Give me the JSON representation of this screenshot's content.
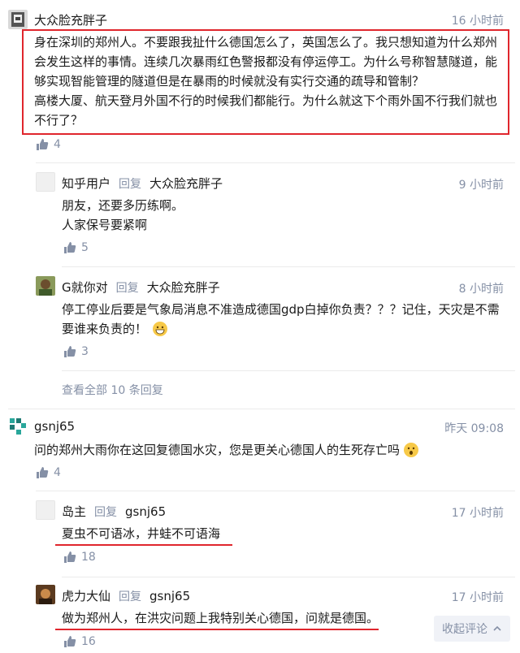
{
  "comments": [
    {
      "author": "大众脸充胖子",
      "time": "16 小时前",
      "lines": [
        "身在深圳的郑州人。不要跟我扯什么德国怎么了，英国怎么了。我只想知道为什么郑州",
        "会发生这样的事情。连续几次暴雨红色警报都没有停运停工。为什么号称智慧隧道，能",
        "够实现智能管理的隧道但是在暴雨的时候就没有实行交通的疏导和管制？",
        "高楼大厦、航天登月外国不行的时候我们都能行。为什么就这下个雨外国不行我们就也",
        "不行了？"
      ],
      "likes": "4",
      "replies": [
        {
          "author": "知乎用户",
          "reply_word": "回复",
          "reply_to": "大众脸充胖子",
          "time": "9 小时前",
          "lines": [
            "朋友，还要多历练啊。",
            "人家保号要紧啊"
          ],
          "likes": "5"
        },
        {
          "author": "G就你对",
          "reply_word": "回复",
          "reply_to": "大众脸充胖子",
          "time": "8 小时前",
          "lines": [
            "停工停业后要是气象局消息不准造成德国gdp白掉你负责？？？记住，天灾是不需",
            "要谁来负责的！"
          ],
          "likes": "3"
        }
      ],
      "view_all": "查看全部 10 条回复"
    },
    {
      "author": "gsnj65",
      "time": "昨天 09:08",
      "lines": [
        "问的郑州大雨你在这回复德国水灾，您是更关心德国人的生死存亡吗"
      ],
      "likes": "4",
      "replies": [
        {
          "author": "岛主",
          "reply_word": "回复",
          "reply_to": "gsnj65",
          "time": "17 小时前",
          "lines": [
            "夏虫不可语冰，井蛙不可语海"
          ],
          "likes": "18"
        },
        {
          "author": "虎力大仙",
          "reply_word": "回复",
          "reply_to": "gsnj65",
          "time": "17 小时前",
          "lines": [
            "做为郑州人，在洪灾问题上我特别关心德国，问就是德国。"
          ],
          "likes": "16"
        }
      ]
    }
  ],
  "collapse_label": "收起评论",
  "colors": {
    "accent_red": "#e0262d",
    "meta_gray": "#8590a6"
  }
}
